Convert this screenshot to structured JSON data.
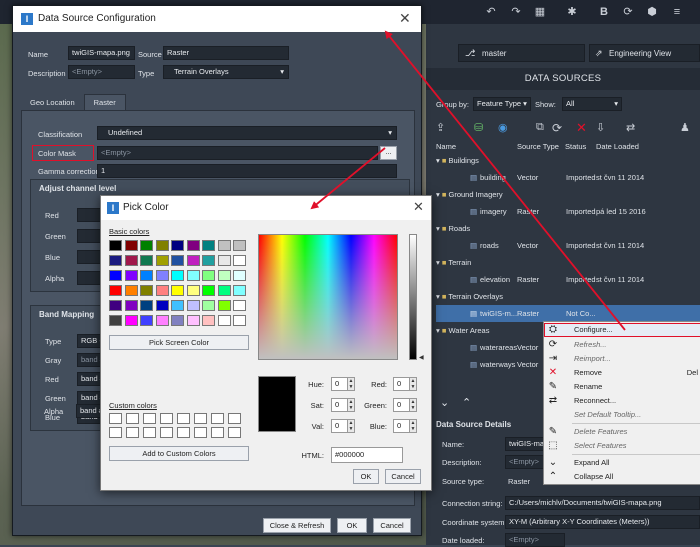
{
  "app": {
    "branch": "master",
    "view_mode": "Engineering View"
  },
  "config_dialog": {
    "title": "Data Source Configuration",
    "name_label": "Name",
    "name_value": "twiGIS-mapa.png",
    "source_label": "Source",
    "source_value": "Raster",
    "description_label": "Description",
    "description_placeholder": "<Empty>",
    "type_label": "Type",
    "type_value": "Terrain Overlays",
    "tabs": [
      "Geo Location",
      "Raster"
    ],
    "classification_label": "Classification",
    "classification_value": "Undefined",
    "color_mask_label": "Color Mask",
    "color_mask_placeholder": "<Empty>",
    "gamma_label": "Gamma correction",
    "gamma_value": "1",
    "adjust_channel_title": "Adjust channel level",
    "channels": [
      "Red",
      "Green",
      "Blue",
      "Alpha"
    ],
    "band_mapping_title": "Band Mapping",
    "band_type_label": "Type",
    "band_type_value": "RGB + A",
    "bands": [
      {
        "label": "Gray",
        "value": "band #"
      },
      {
        "label": "Red",
        "value": "band #"
      },
      {
        "label": "Green",
        "value": "band #"
      },
      {
        "label": "Blue",
        "value": "band #"
      },
      {
        "label": "Alpha",
        "value": "band #"
      }
    ],
    "close_refresh": "Close & Refresh",
    "ok": "OK",
    "cancel": "Cancel"
  },
  "pick_color": {
    "title": "Pick Color",
    "basic_colors_label": "Basic colors",
    "basic_colors": [
      "#000000",
      "#800000",
      "#008000",
      "#808000",
      "#000080",
      "#800080",
      "#008080",
      "#c0c0c0",
      "#c0c0c0",
      "#1a1a80",
      "#a0184c",
      "#107850",
      "#a0a000",
      "#2050a0",
      "#c020c0",
      "#20a0a0",
      "#e8e8e8",
      "#ffffff",
      "#0000ff",
      "#8000ff",
      "#0080ff",
      "#8080ff",
      "#00ffff",
      "#80ffff",
      "#80ff80",
      "#c0ffc0",
      "#e0ffff",
      "#ff0000",
      "#ff8000",
      "#808000",
      "#ff8080",
      "#ffff00",
      "#ffff80",
      "#00ff00",
      "#00ff80",
      "#80ffff",
      "#400080",
      "#8000c0",
      "#004080",
      "#0000c0",
      "#40c0ff",
      "#c0c0ff",
      "#a0ffa0",
      "#80ff00",
      "#ffffff",
      "#404040",
      "#ff00ff",
      "#4040ff",
      "#ff80ff",
      "#8080c0",
      "#ffc0ff",
      "#ffc0c0",
      "#ffffff",
      "#ffffff"
    ],
    "pick_screen": "Pick Screen Color",
    "custom_colors_label": "Custom colors",
    "add_custom": "Add to Custom Colors",
    "hue_label": "Hue:",
    "hue": "0",
    "sat_label": "Sat:",
    "sat": "0",
    "val_label": "Val:",
    "val": "0",
    "red_label": "Red:",
    "red": "0",
    "green_label": "Green:",
    "green": "0",
    "blue_label": "Blue:",
    "blue": "0",
    "html_label": "HTML:",
    "html": "#000000",
    "ok": "OK",
    "cancel": "Cancel"
  },
  "data_sources": {
    "header": "DATA SOURCES",
    "group_by_label": "Group by:",
    "group_by_value": "Feature Type",
    "show_label": "Show:",
    "show_value": "All",
    "columns": [
      "Name",
      "Source Type",
      "Status",
      "Date Loaded"
    ],
    "groups": [
      {
        "name": "Buildings",
        "items": [
          {
            "name": "building",
            "type": "Vector",
            "status": "Imported",
            "date": "st čvn 11 2014"
          }
        ]
      },
      {
        "name": "Ground Imagery",
        "items": [
          {
            "name": "imagery",
            "type": "Raster",
            "status": "Imported",
            "date": "pá led 15 2016"
          }
        ]
      },
      {
        "name": "Roads",
        "items": [
          {
            "name": "roads",
            "type": "Vector",
            "status": "Imported",
            "date": "st čvn 11 2014"
          }
        ]
      },
      {
        "name": "Terrain",
        "items": [
          {
            "name": "elevation",
            "type": "Raster",
            "status": "Imported",
            "date": "st čvn 11 2014"
          }
        ]
      },
      {
        "name": "Terrain Overlays",
        "items": [
          {
            "name": "twiGIS-m...",
            "type": "Raster",
            "status": "Not Co...",
            "date": ""
          }
        ]
      },
      {
        "name": "Water Areas",
        "items": [
          {
            "name": "waterareas",
            "type": "Vector",
            "status": "",
            "date": ""
          },
          {
            "name": "waterways",
            "type": "Vector",
            "status": "",
            "date": ""
          }
        ]
      }
    ],
    "details_title": "Data Source Details",
    "details": [
      {
        "label": "Name:",
        "value": "twiGIS-map"
      },
      {
        "label": "Description:",
        "value": "<Empty>"
      },
      {
        "label": "Source type:",
        "value": "Raster"
      },
      {
        "label": "Connection string:",
        "value": "C:/Users/michlv/Documents/twiGIS-mapa.png"
      },
      {
        "label": "Coordinate system:",
        "value": "XY-M (Arbitrary X-Y Coordinates (Meters))"
      },
      {
        "label": "Date loaded:",
        "value": "<Empty>"
      }
    ]
  },
  "context_menu": {
    "items": [
      {
        "label": "Configure...",
        "disabled": false,
        "highlighted": true
      },
      {
        "label": "Refresh...",
        "disabled": true
      },
      {
        "label": "Reimport...",
        "disabled": true
      },
      {
        "label": "Remove",
        "disabled": false,
        "shortcut": "Del"
      },
      {
        "label": "Rename",
        "disabled": false
      },
      {
        "label": "Reconnect...",
        "disabled": false
      },
      {
        "label": "Set Default Tooltip...",
        "disabled": true
      },
      {
        "label": "Delete Features",
        "disabled": true
      },
      {
        "label": "Select Features",
        "disabled": true
      },
      {
        "label": "Expand All",
        "disabled": false
      },
      {
        "label": "Collapse All",
        "disabled": false
      }
    ]
  },
  "colors": {
    "accent_red": "#e0102a",
    "dark_bg": "#2e3641",
    "dialog_bg": "#3e4856"
  }
}
